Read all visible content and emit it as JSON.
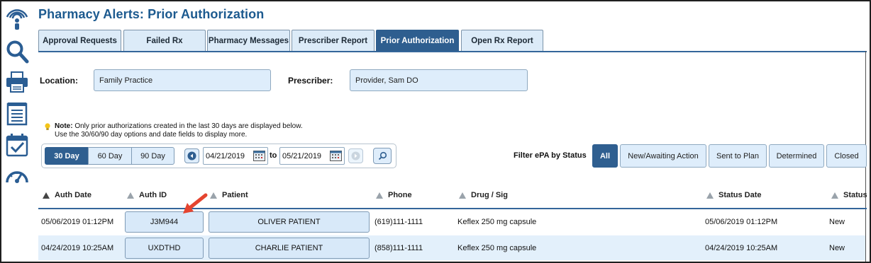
{
  "page_title": "Pharmacy Alerts: Prior Authorization",
  "rail_icons": [
    "signal-icon",
    "search-icon",
    "print-icon",
    "list-icon",
    "calendar-check-icon",
    "dashboard-icon"
  ],
  "tabs": [
    {
      "label": "Approval Requests"
    },
    {
      "label": "Failed Rx"
    },
    {
      "label": "Pharmacy Messages"
    },
    {
      "label": "Prescriber Report"
    },
    {
      "label": "Prior Authorization"
    },
    {
      "label": "Open Rx Report"
    }
  ],
  "active_tab": "Prior Authorization",
  "location": {
    "label": "Location:",
    "value": "Family Practice"
  },
  "prescriber": {
    "label": "Prescriber:",
    "value": "Provider, Sam DO"
  },
  "note": {
    "bold": "Note:",
    "line1": "Only prior authorizations created in the last 30 days are displayed below.",
    "line2": "Use the 30/60/90 day options and date fields to display more."
  },
  "range_buttons": [
    "30 Day",
    "60 Day",
    "90 Day"
  ],
  "selected_range": "30 Day",
  "date_from": "04/21/2019",
  "date_to_label": "to",
  "date_to": "05/21/2019",
  "filter": {
    "label": "Filter ePA by Status",
    "options": [
      "All",
      "New/Awaiting Action",
      "Sent to Plan",
      "Determined",
      "Closed"
    ],
    "selected": "All"
  },
  "table": {
    "columns": [
      "Auth Date",
      "Auth ID",
      "Patient",
      "Phone",
      "Drug / Sig",
      "Status Date",
      "Status"
    ],
    "rows": [
      {
        "auth_date": "05/06/2019 01:12PM",
        "auth_id": "J3M944",
        "patient": "OLIVER PATIENT",
        "phone": "(619)111-1111",
        "drug": "Keflex 250 mg capsule",
        "status_date": "05/06/2019 01:12PM",
        "status": "New"
      },
      {
        "auth_date": "04/24/2019 10:25AM",
        "auth_id": "UXDTHD",
        "patient": "CHARLIE PATIENT",
        "phone": "(858)111-1111",
        "drug": "Keflex 250 mg capsule",
        "status_date": "04/24/2019 10:25AM",
        "status": "New"
      }
    ]
  },
  "colors": {
    "brand": "#1c5a8f",
    "active": "#2e5e8f",
    "button_fill": "#deedfb",
    "annotation_arrow": "#e5442f"
  }
}
